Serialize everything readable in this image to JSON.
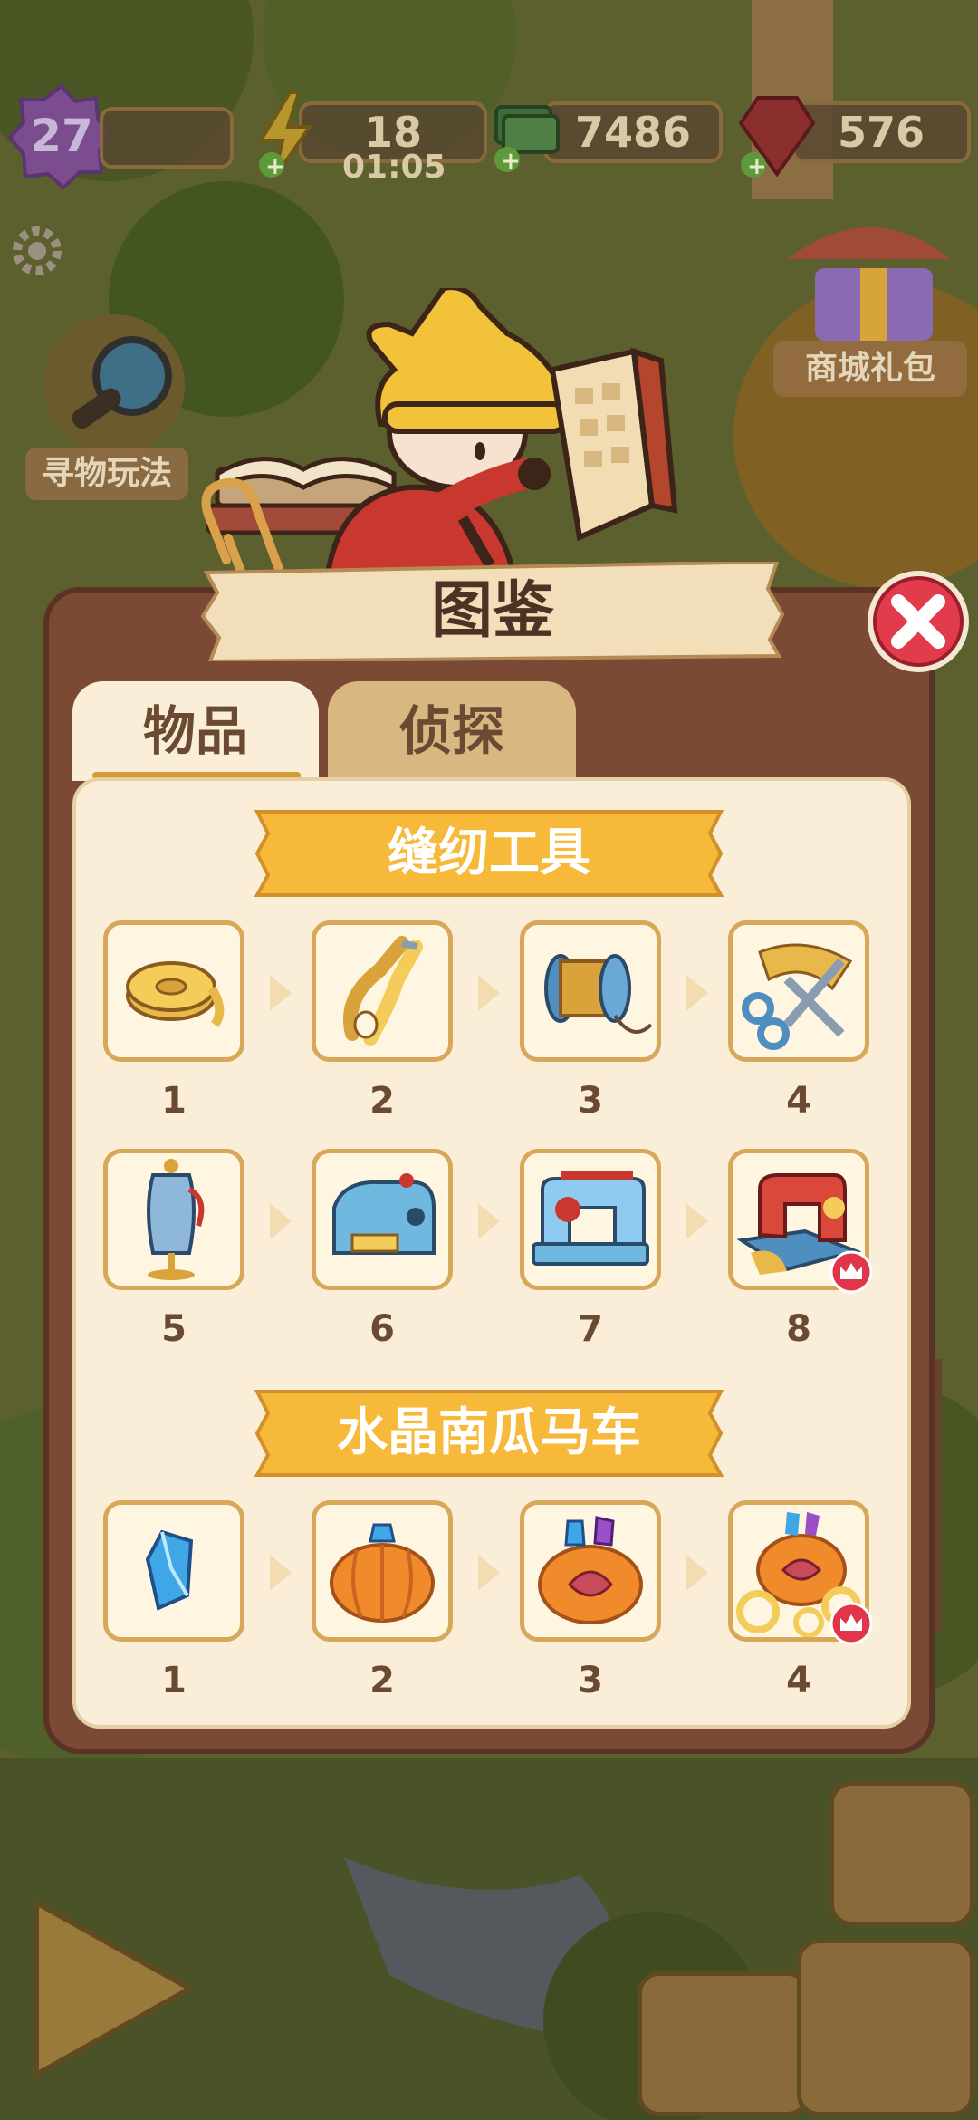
{
  "hud": {
    "level": "27",
    "energy": "18",
    "energy_timer": "01:05",
    "cash": "7486",
    "gems": "576"
  },
  "side": {
    "find_game_label": "寻物玩法",
    "shop_gift_label": "商城礼包"
  },
  "modal": {
    "title": "图鉴",
    "tabs": [
      {
        "label": "物品",
        "active": true
      },
      {
        "label": "侦探",
        "active": false
      }
    ],
    "sections": [
      {
        "title": "缝纫工具",
        "items": [
          {
            "number": "1",
            "icon": "tape-measure-icon"
          },
          {
            "number": "2",
            "icon": "thread-snips-icon"
          },
          {
            "number": "3",
            "icon": "thread-spool-icon"
          },
          {
            "number": "4",
            "icon": "scissors-ribbon-icon"
          },
          {
            "number": "5",
            "icon": "dress-form-icon"
          },
          {
            "number": "6",
            "icon": "small-sewing-machine-icon"
          },
          {
            "number": "7",
            "icon": "sewing-machine-icon"
          },
          {
            "number": "8",
            "icon": "vintage-sewing-machine-icon",
            "max": true
          }
        ]
      },
      {
        "title": "水晶南瓜马车",
        "items": [
          {
            "number": "1",
            "icon": "crystal-icon"
          },
          {
            "number": "2",
            "icon": "pumpkin-crystal-icon"
          },
          {
            "number": "3",
            "icon": "pumpkin-gems-icon"
          },
          {
            "number": "4",
            "icon": "pumpkin-carriage-icon",
            "max": true
          }
        ]
      }
    ]
  },
  "colors": {
    "modal_frame": "#7a4a35",
    "panel": "#faeed8",
    "banner": "#f6b93a",
    "close_red": "#e23b4b",
    "crown_badge": "#e0354a"
  }
}
